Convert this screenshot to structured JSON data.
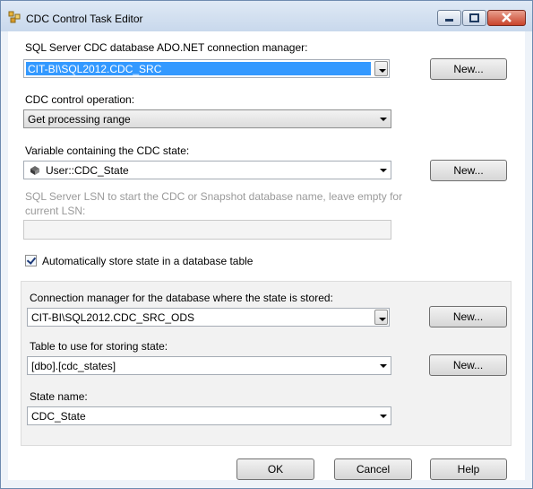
{
  "window": {
    "title": "CDC Control Task Editor"
  },
  "connection": {
    "label": "SQL Server CDC database ADO.NET connection manager:",
    "value": "CIT-BI\\SQL2012.CDC_SRC",
    "new_label": "New..."
  },
  "operation": {
    "label": "CDC control operation:",
    "value": "Get processing range"
  },
  "variable": {
    "label": "Variable containing the CDC state:",
    "value": "User::CDC_State",
    "new_label": "New..."
  },
  "lsn": {
    "label_line1": "SQL Server LSN to start the CDC or Snapshot database name, leave empty for",
    "label_line2": "current LSN:",
    "value": ""
  },
  "auto_store": {
    "label": "Automatically store state in a database table",
    "checked": true
  },
  "state_connection": {
    "label": "Connection manager for the database where the state is stored:",
    "value": "CIT-BI\\SQL2012.CDC_SRC_ODS",
    "new_label": "New..."
  },
  "state_table": {
    "label": "Table to use for storing state:",
    "value": "[dbo].[cdc_states]",
    "new_label": "New..."
  },
  "state_name": {
    "label": "State name:",
    "value": "CDC_State"
  },
  "footer": {
    "ok_label": "OK",
    "cancel_label": "Cancel",
    "help_label": "Help"
  }
}
